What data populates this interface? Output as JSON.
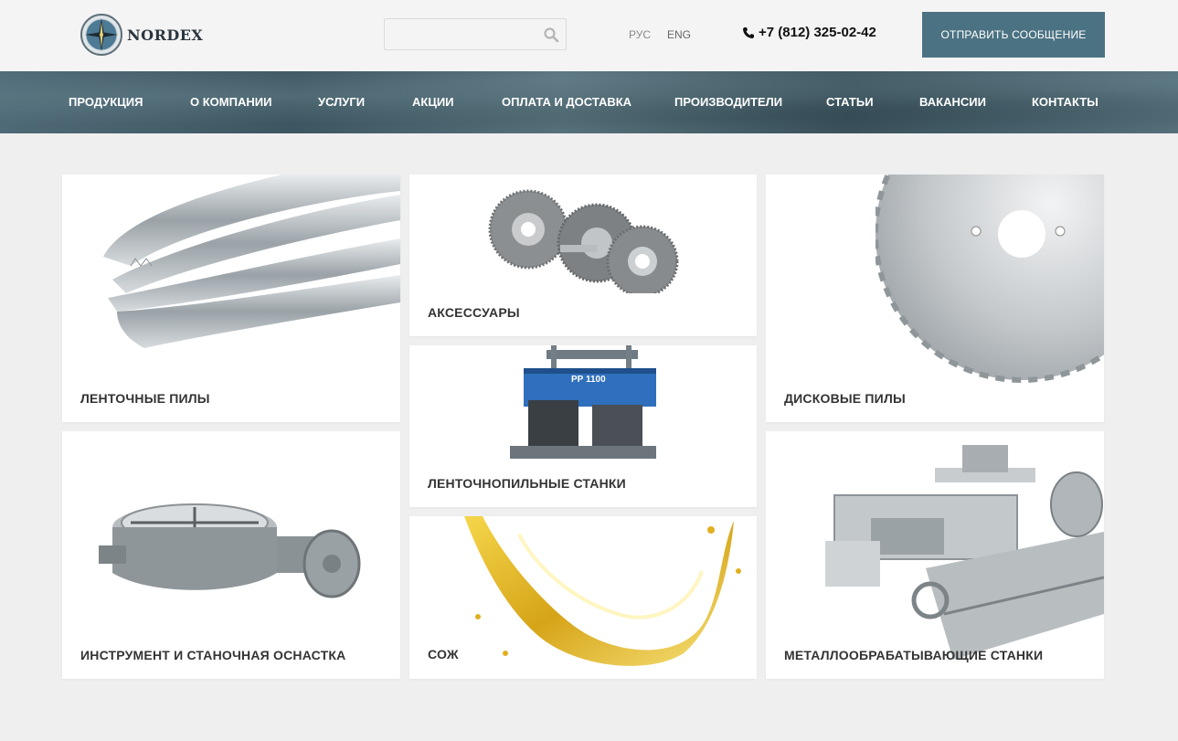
{
  "header": {
    "logo_text": "NORDEX",
    "search": {
      "placeholder": "",
      "value": ""
    },
    "languages": [
      "РУС",
      "ENG"
    ],
    "phone": "+7 (812) 325-02-42",
    "send_button": "ОТПРАВИТЬ СООБЩЕНИЕ"
  },
  "nav": {
    "items": [
      "ПРОДУКЦИЯ",
      "О КОМПАНИИ",
      "УСЛУГИ",
      "АКЦИИ",
      "ОПЛАТА И ДОСТАВКА",
      "ПРОИЗВОДИТЕЛИ",
      "СТАТЬИ",
      "ВАКАНСИИ",
      "КОНТАКТЫ"
    ]
  },
  "categories": [
    {
      "label": "ЛЕНТОЧНЫЕ ПИЛЫ",
      "icon": "band-saw-blade-image"
    },
    {
      "label": "АКСЕССУАРЫ",
      "icon": "wire-brush-image"
    },
    {
      "label": "ДИСКОВЫЕ ПИЛЫ",
      "icon": "circular-saw-blade-image"
    },
    {
      "label": "ЛЕНТОЧНОПИЛЬНЫЕ СТАНКИ",
      "icon": "bandsaw-machine-image"
    },
    {
      "label": "ИНСТРУМЕНТ И СТАНОЧНАЯ ОСНАСТКА",
      "icon": "rotary-table-image"
    },
    {
      "label": "СОЖ",
      "icon": "coolant-splash-image"
    },
    {
      "label": "МЕТАЛЛООБРАБАТЫВАЮЩИЕ СТАНКИ",
      "icon": "lathe-image"
    }
  ],
  "machine_badge": "PP 1100",
  "colors": {
    "accent": "#4b7282",
    "nav_bg": "#4e6a76",
    "page_bg": "#efefef"
  }
}
